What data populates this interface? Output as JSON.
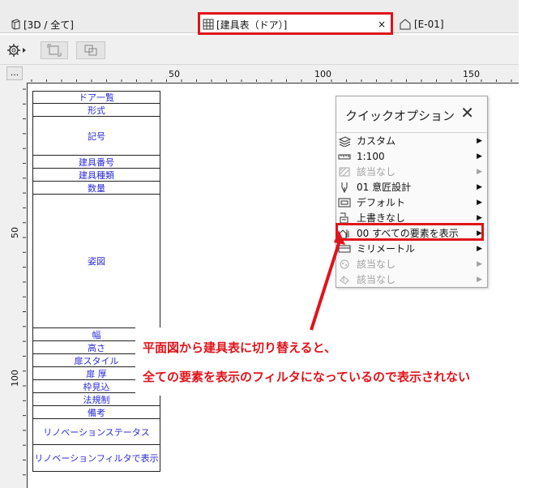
{
  "tabs": [
    {
      "label": "[3D / 全て]",
      "icon": "3d-view-icon"
    },
    {
      "label": "[建具表（ドア）]",
      "icon": "schedule-grid-icon"
    },
    {
      "label": "[E-01]",
      "icon": "elevation-icon"
    }
  ],
  "tab_close": "×",
  "ruler_button": "...",
  "ruler": {
    "h_labels": [
      "50",
      "100",
      "150"
    ],
    "v_labels": [
      "50",
      "100"
    ]
  },
  "schedule": {
    "rows": [
      "ドア一覧",
      "形式",
      "記号",
      "建具番号",
      "建具種類",
      "数量",
      "姿図",
      "幅",
      "高さ",
      "扉スタイル",
      "扉 厚",
      "枠見込",
      "法規制",
      "備考",
      "リノベーションステータス",
      "リノベーションフィルタで表示"
    ]
  },
  "quick_options": {
    "title": "クイックオプション",
    "close": "✕",
    "items": [
      {
        "label": "カスタム",
        "icon": "layers-icon",
        "disabled": false
      },
      {
        "label": "1:100",
        "icon": "scale-ruler-icon",
        "disabled": false
      },
      {
        "label": "該当なし",
        "icon": "hatch-icon",
        "disabled": true
      },
      {
        "label": "01 意匠設計",
        "icon": "pen-icon",
        "disabled": false
      },
      {
        "label": "デフォルト",
        "icon": "model-view-icon",
        "disabled": false
      },
      {
        "label": "上書きなし",
        "icon": "override-icon",
        "disabled": false
      },
      {
        "label": "00 すべての要素を表示",
        "icon": "renovation-filter-icon",
        "disabled": false
      },
      {
        "label": "ミリメートル",
        "icon": "dimension-icon",
        "disabled": false
      },
      {
        "label": "該当なし",
        "icon": "structure-icon",
        "disabled": true
      },
      {
        "label": "該当なし",
        "icon": "partial-display-icon",
        "disabled": true
      }
    ]
  },
  "annotation": {
    "line1": "平面図から建具表に切り替えると、",
    "line2": "全ての要素を表示のフィルタになっているので表示されない"
  },
  "colors": {
    "highlight": "#e0141b",
    "schedule_text": "#2a2ad8"
  }
}
